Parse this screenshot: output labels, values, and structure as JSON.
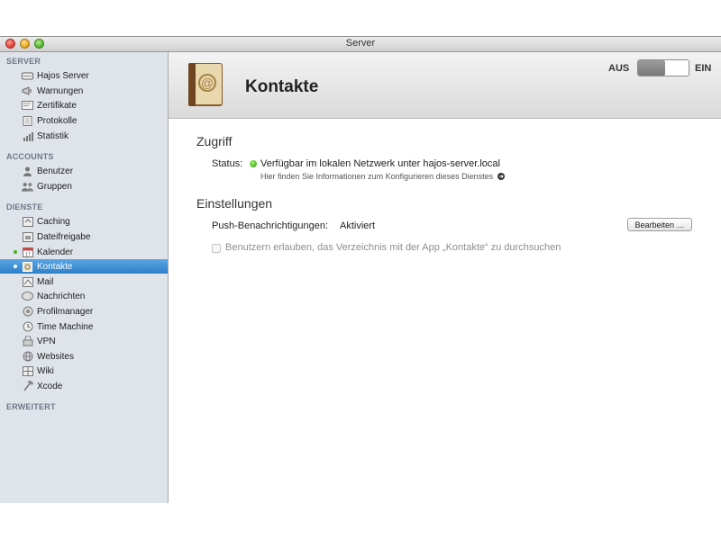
{
  "window": {
    "title": "Server"
  },
  "sidebar": {
    "sections": {
      "server": "SERVER",
      "accounts": "ACCOUNTS",
      "dienste": "DIENSTE",
      "erweitert": "ERWEITERT"
    },
    "server_items": [
      {
        "label": "Hajos Server",
        "icon": "server-icon"
      },
      {
        "label": "Warnungen",
        "icon": "megaphone-icon"
      },
      {
        "label": "Zertifikate",
        "icon": "certificate-icon"
      },
      {
        "label": "Protokolle",
        "icon": "log-icon"
      },
      {
        "label": "Statistik",
        "icon": "bar-chart-icon"
      }
    ],
    "account_items": [
      {
        "label": "Benutzer",
        "icon": "user-icon"
      },
      {
        "label": "Gruppen",
        "icon": "group-icon"
      }
    ],
    "service_items": [
      {
        "label": "Caching",
        "icon": "caching-icon"
      },
      {
        "label": "Dateifreigabe",
        "icon": "folder-share-icon"
      },
      {
        "label": "Kalender",
        "icon": "calendar-icon",
        "status": "green"
      },
      {
        "label": "Kontakte",
        "icon": "contacts-icon",
        "status": "selected"
      },
      {
        "label": "Mail",
        "icon": "mail-icon"
      },
      {
        "label": "Nachrichten",
        "icon": "messages-icon"
      },
      {
        "label": "Profilmanager",
        "icon": "profile-manager-icon"
      },
      {
        "label": "Time Machine",
        "icon": "time-machine-icon"
      },
      {
        "label": "VPN",
        "icon": "vpn-icon"
      },
      {
        "label": "Websites",
        "icon": "globe-icon"
      },
      {
        "label": "Wiki",
        "icon": "wiki-icon"
      },
      {
        "label": "Xcode",
        "icon": "hammer-icon"
      }
    ]
  },
  "header": {
    "title": "Kontakte",
    "switch_off": "AUS",
    "switch_on": "EIN"
  },
  "zugriff": {
    "heading": "Zugriff",
    "status_label": "Status:",
    "status_text": "Verfügbar im lokalen Netzwerk unter hajos-server.local",
    "info_text": "Hier finden Sie Informationen zum Konfigurieren dieses Dienstes"
  },
  "einstellungen": {
    "heading": "Einstellungen",
    "push_label": "Push-Benachrichtigungen:",
    "push_value": "Aktiviert",
    "edit_button": "Bearbeiten …",
    "checkbox_label": "Benutzern erlauben, das Verzeichnis mit der App „Kontakte“ zu durchsuchen"
  },
  "colors": {
    "selection": "#2d7fc9",
    "status_green": "#47b21c",
    "sidebar_bg": "#dfe4ea"
  }
}
